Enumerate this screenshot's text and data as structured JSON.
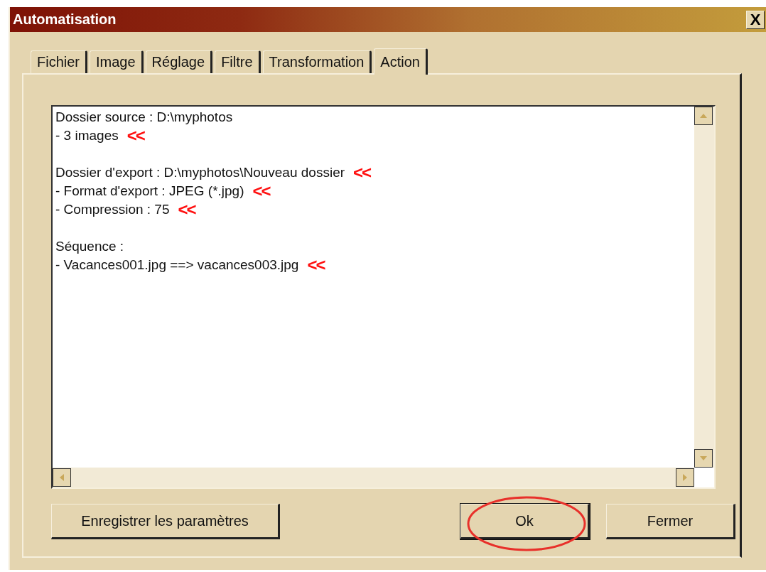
{
  "window": {
    "title": "Automatisation",
    "close_glyph": "X"
  },
  "tabs": [
    {
      "label": "Fichier",
      "selected": false
    },
    {
      "label": "Image",
      "selected": false
    },
    {
      "label": "Réglage",
      "selected": false
    },
    {
      "label": "Filtre",
      "selected": false
    },
    {
      "label": "Transformation",
      "selected": false
    },
    {
      "label": "Action",
      "selected": true
    }
  ],
  "log": {
    "paragraphs": [
      {
        "lines": [
          {
            "text": "Dossier source : D:\\myphotos"
          },
          {
            "text": "- 3 images",
            "marker": "<<"
          }
        ]
      },
      {
        "lines": [
          {
            "text": "Dossier d'export : D:\\myphotos\\Nouveau dossier",
            "marker": "<<"
          },
          {
            "text": "- Format d'export : JPEG (*.jpg)",
            "marker": "<<"
          },
          {
            "text": "- Compression : 75",
            "marker": "<<"
          }
        ]
      },
      {
        "lines": [
          {
            "text": "Séquence :"
          },
          {
            "text": "- Vacances001.jpg ==> vacances003.jpg",
            "marker": "<<"
          }
        ]
      }
    ]
  },
  "buttons": [
    {
      "label": "Enregistrer les paramètres",
      "default": false,
      "circled": false
    },
    {
      "label": "Ok",
      "default": true,
      "circled": true
    },
    {
      "label": "Fermer",
      "default": false,
      "circled": false
    }
  ]
}
